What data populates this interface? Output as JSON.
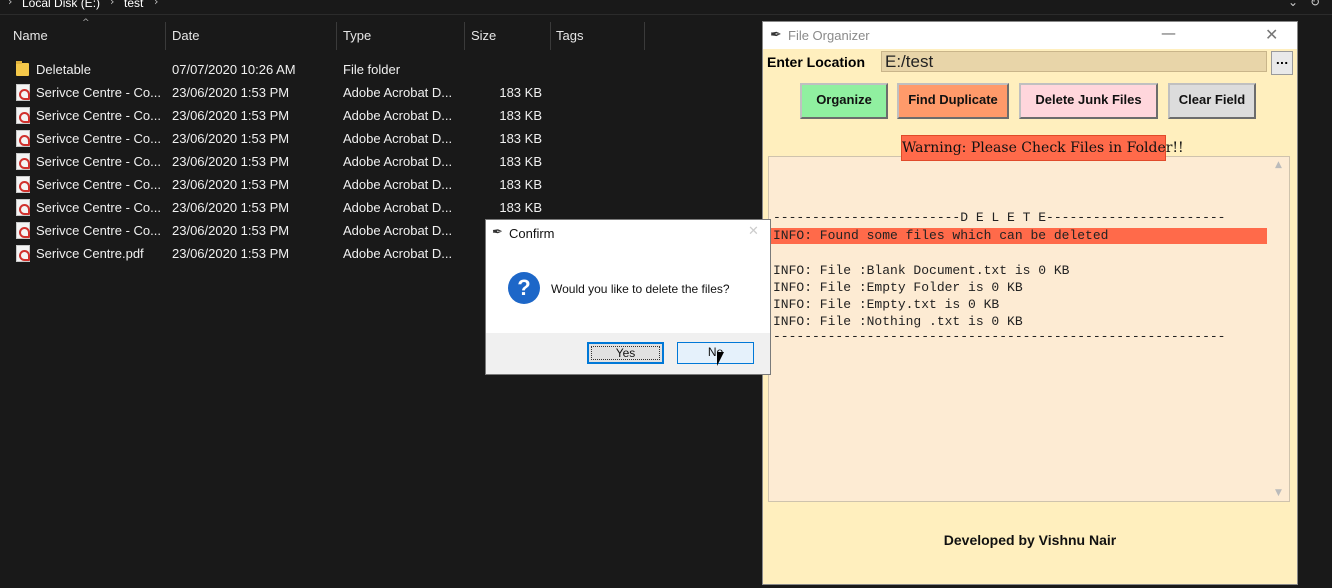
{
  "explorer": {
    "breadcrumb": [
      "Local Disk (E:)",
      "test"
    ],
    "columns": [
      "Name",
      "Date",
      "Type",
      "Size",
      "Tags"
    ],
    "rows": [
      {
        "name": "Deletable",
        "date": "07/07/2020 10:26 AM",
        "type": "File folder",
        "size": "",
        "icon": "folder-icon"
      },
      {
        "name": "Serivce Centre - Co...",
        "date": "23/06/2020 1:53 PM",
        "type": "Adobe Acrobat D...",
        "size": "183 KB",
        "icon": "pdf-icon"
      },
      {
        "name": "Serivce Centre - Co...",
        "date": "23/06/2020 1:53 PM",
        "type": "Adobe Acrobat D...",
        "size": "183 KB",
        "icon": "pdf-icon"
      },
      {
        "name": "Serivce Centre - Co...",
        "date": "23/06/2020 1:53 PM",
        "type": "Adobe Acrobat D...",
        "size": "183 KB",
        "icon": "pdf-icon"
      },
      {
        "name": "Serivce Centre - Co...",
        "date": "23/06/2020 1:53 PM",
        "type": "Adobe Acrobat D...",
        "size": "183 KB",
        "icon": "pdf-icon"
      },
      {
        "name": "Serivce Centre - Co...",
        "date": "23/06/2020 1:53 PM",
        "type": "Adobe Acrobat D...",
        "size": "183 KB",
        "icon": "pdf-icon"
      },
      {
        "name": "Serivce Centre - Co...",
        "date": "23/06/2020 1:53 PM",
        "type": "Adobe Acrobat D...",
        "size": "183 KB",
        "icon": "pdf-icon"
      },
      {
        "name": "Serivce Centre - Co...",
        "date": "23/06/2020 1:53 PM",
        "type": "Adobe Acrobat D...",
        "size": "",
        "icon": "pdf-icon"
      },
      {
        "name": "Serivce Centre.pdf",
        "date": "23/06/2020 1:53 PM",
        "type": "Adobe Acrobat D...",
        "size": "",
        "icon": "pdf-icon"
      }
    ]
  },
  "organizer": {
    "title": "File Organizer",
    "location_label": "Enter Location",
    "location_value": "E:/test",
    "browse_label": "...",
    "buttons": {
      "organize": "Organize",
      "find_duplicate": "Find Duplicate",
      "delete_junk": "Delete Junk Files",
      "clear_field": "Clear Field"
    },
    "warning": "Warning: Please Check Files in Folder!!",
    "log_lines": [
      "------------------------D E L E T E-----------------------",
      "INFO: Found some files which can be deleted",
      "",
      "INFO: File :Blank Document.txt is 0 KB",
      "INFO: File :Empty Folder is 0 KB",
      "INFO: File :Empty.txt is 0 KB",
      "INFO: File :Nothing .txt is 0 KB",
      "----------------------------------------------------------"
    ],
    "footer": "Developed by Vishnu Nair",
    "colors": {
      "background": "#ffefbe",
      "organize": "#90f0a0",
      "find_duplicate": "#ff9a6a",
      "delete_junk": "#ffd6dc",
      "clear_field": "#dcdcdc",
      "warning": "#ff6a4a"
    }
  },
  "dialog": {
    "title": "Confirm",
    "message": "Would you like to delete the files?",
    "yes_label": "Yes",
    "no_label": "No",
    "icon": "question-icon"
  }
}
